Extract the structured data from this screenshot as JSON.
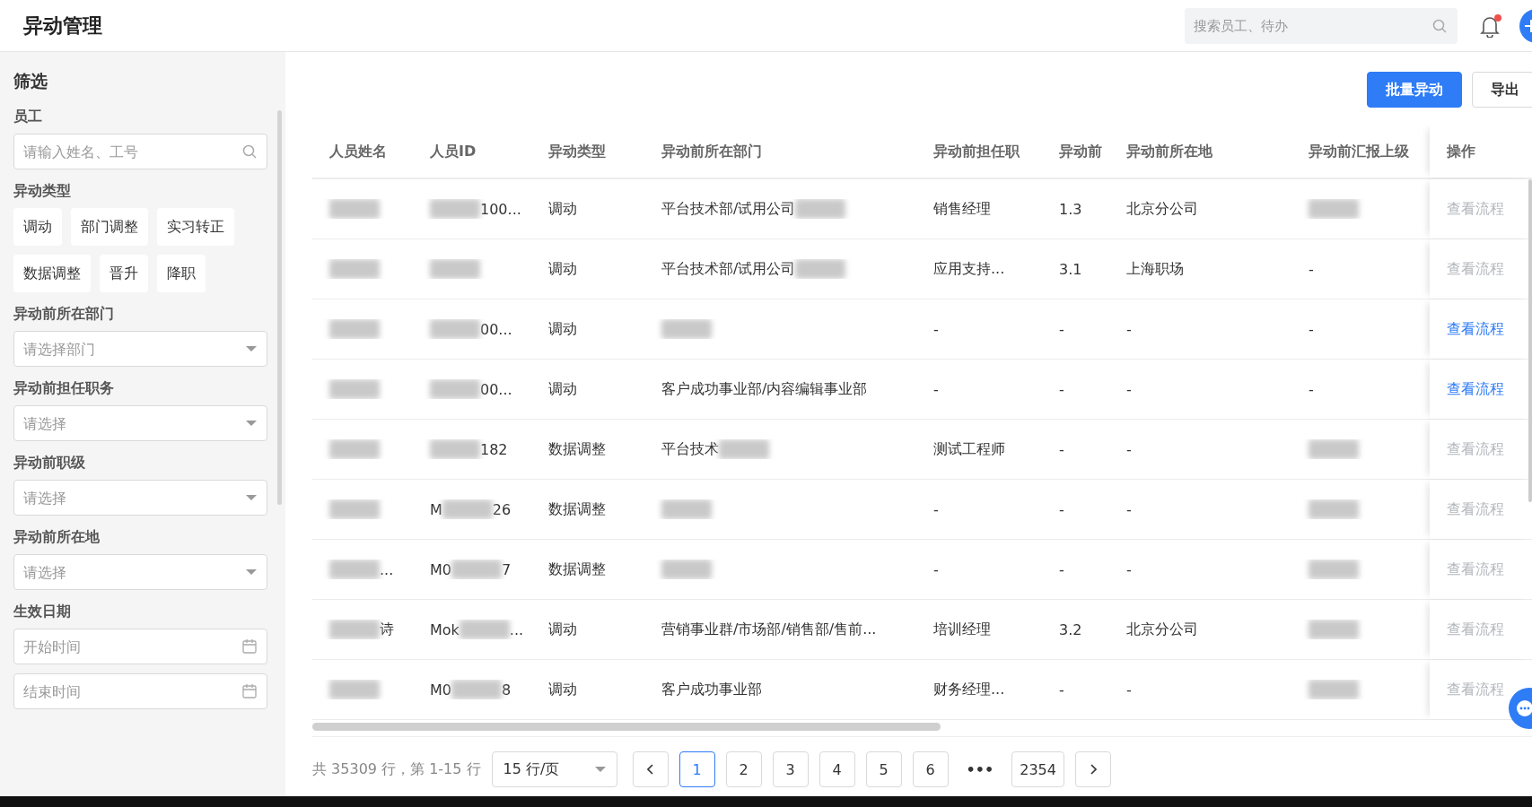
{
  "header": {
    "title": "异动管理",
    "search": {
      "placeholder": "搜索员工、待办"
    },
    "notification_unread": true
  },
  "sidebar": {
    "title": "筛选",
    "employee": {
      "label": "员工",
      "placeholder": "请输入姓名、工号"
    },
    "change_types": {
      "label": "异动类型",
      "options": [
        {
          "label": "调动",
          "selected": false
        },
        {
          "label": "部门调整",
          "selected": false
        },
        {
          "label": "实习转正",
          "selected": false
        },
        {
          "label": "数据调整",
          "selected": false
        },
        {
          "label": "晋升",
          "selected": false
        },
        {
          "label": "降职",
          "selected": false
        }
      ]
    },
    "filters": [
      {
        "kind": "select",
        "label": "异动前所在部门",
        "placeholder": "请选择部门"
      },
      {
        "kind": "select",
        "label": "异动前担任职务",
        "placeholder": "请选择"
      },
      {
        "kind": "select",
        "label": "异动前职级",
        "placeholder": "请选择"
      },
      {
        "kind": "select",
        "label": "异动前所在地",
        "placeholder": "请选择"
      },
      {
        "kind": "date",
        "label": "生效日期",
        "placeholder": "开始时间"
      },
      {
        "kind": "date",
        "placeholder": "结束时间"
      }
    ]
  },
  "toolbar": {
    "buttons": [
      {
        "label": "批量异动",
        "kind": "primary"
      },
      {
        "label": "导出",
        "kind": "default"
      }
    ]
  },
  "table": {
    "columns": [
      "人员姓名",
      "人员ID",
      "异动类型",
      "异动前所在部门",
      "异动前担任职",
      "异动前",
      "异动前所在地",
      "异动前汇报上级",
      "操作"
    ],
    "rows": [
      {
        "cells": [
          [
            null
          ],
          [
            null,
            "100..."
          ],
          [
            "调动"
          ],
          [
            "平台技术部/试用公司",
            null
          ],
          [
            "销售经理"
          ],
          [
            "1.3"
          ],
          [
            "北京分公司"
          ],
          [
            null
          ]
        ],
        "action": {
          "label": "查看流程",
          "disabled": true
        }
      },
      {
        "cells": [
          [
            null
          ],
          [
            null
          ],
          [
            "调动"
          ],
          [
            "平台技术部/试用公司",
            null
          ],
          [
            "应用支持..."
          ],
          [
            "3.1"
          ],
          [
            "上海职场"
          ],
          [
            "-"
          ]
        ],
        "action": {
          "label": "查看流程",
          "disabled": true
        }
      },
      {
        "cells": [
          [
            null
          ],
          [
            null,
            "00..."
          ],
          [
            "调动"
          ],
          [
            null
          ],
          [
            "-"
          ],
          [
            "-"
          ],
          [
            "-"
          ],
          [
            "-"
          ]
        ],
        "action": {
          "label": "查看流程",
          "disabled": false
        }
      },
      {
        "cells": [
          [
            null
          ],
          [
            null,
            "00..."
          ],
          [
            "调动"
          ],
          [
            "客户成功事业部/内容编辑事业部"
          ],
          [
            "-"
          ],
          [
            "-"
          ],
          [
            "-"
          ],
          [
            "-"
          ]
        ],
        "action": {
          "label": "查看流程",
          "disabled": false
        }
      },
      {
        "cells": [
          [
            null
          ],
          [
            null,
            "182"
          ],
          [
            "数据调整"
          ],
          [
            "平台技术",
            null
          ],
          [
            "测试工程师"
          ],
          [
            "-"
          ],
          [
            "-"
          ],
          [
            null
          ]
        ],
        "action": {
          "label": "查看流程",
          "disabled": true
        }
      },
      {
        "cells": [
          [
            null
          ],
          [
            "M",
            null,
            "26"
          ],
          [
            "数据调整"
          ],
          [
            null
          ],
          [
            "-"
          ],
          [
            "-"
          ],
          [
            "-"
          ],
          [
            null
          ]
        ],
        "action": {
          "label": "查看流程",
          "disabled": true
        }
      },
      {
        "cells": [
          [
            null,
            "..."
          ],
          [
            "M0",
            null,
            "7"
          ],
          [
            "数据调整"
          ],
          [
            null
          ],
          [
            "-"
          ],
          [
            "-"
          ],
          [
            "-"
          ],
          [
            null
          ]
        ],
        "action": {
          "label": "查看流程",
          "disabled": true
        }
      },
      {
        "cells": [
          [
            null,
            "诗"
          ],
          [
            "Mok",
            null,
            "..."
          ],
          [
            "调动"
          ],
          [
            "营销事业群/市场部/销售部/售前..."
          ],
          [
            "培训经理"
          ],
          [
            "3.2"
          ],
          [
            "北京分公司"
          ],
          [
            null
          ]
        ],
        "action": {
          "label": "查看流程",
          "disabled": true
        }
      },
      {
        "cells": [
          [
            null
          ],
          [
            "M0",
            null,
            "8"
          ],
          [
            "调动"
          ],
          [
            "客户成功事业部"
          ],
          [
            "财务经理..."
          ],
          [
            "-"
          ],
          [
            "-"
          ],
          [
            null
          ]
        ],
        "action": {
          "label": "查看流程",
          "disabled": true
        }
      }
    ]
  },
  "pagination": {
    "summary": "共 35309 行，第 1-15 行",
    "page_size": "15 行/页",
    "pages": [
      {
        "label": "1",
        "selected": true
      },
      {
        "label": "2",
        "selected": false
      },
      {
        "label": "3",
        "selected": false
      },
      {
        "label": "4",
        "selected": false
      },
      {
        "label": "5",
        "selected": false
      },
      {
        "label": "6",
        "selected": false
      },
      {
        "label": "•••",
        "kind": "ellipsis",
        "selected": false
      },
      {
        "label": "2354",
        "selected": false
      }
    ]
  }
}
